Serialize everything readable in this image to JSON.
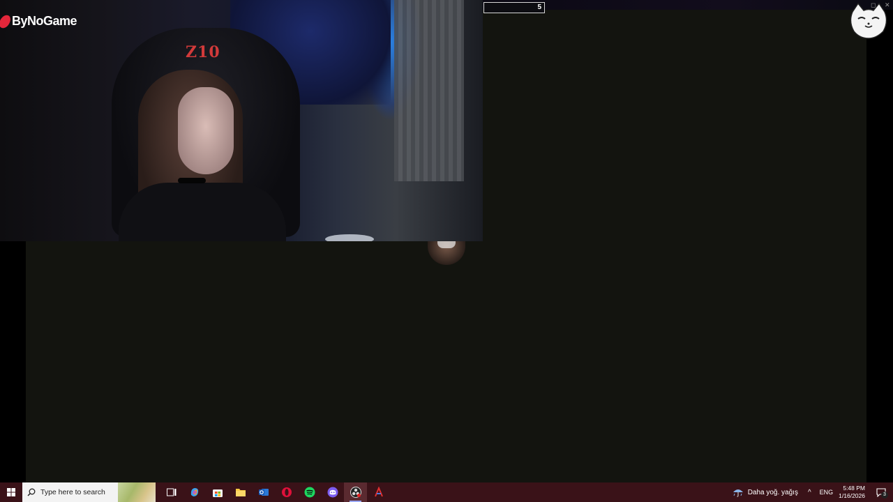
{
  "overlay": {
    "brand_name": "ByNoGame",
    "counter_value": "5",
    "chair_logo_text": "Z10"
  },
  "taskbar": {
    "search_placeholder": "Type here to search",
    "apps": [
      {
        "name": "task-view-icon"
      },
      {
        "name": "copilot-icon"
      },
      {
        "name": "microsoft-store-icon"
      },
      {
        "name": "file-explorer-icon"
      },
      {
        "name": "outlook-icon"
      },
      {
        "name": "opera-gx-icon"
      },
      {
        "name": "spotify-icon"
      },
      {
        "name": "discord-icon"
      },
      {
        "name": "obs-icon",
        "active": true
      },
      {
        "name": "app-icon"
      }
    ],
    "weather_text": "Daha yoğ. yağış",
    "language": "ENG",
    "time": "5:48 PM",
    "date": "1/16/2026",
    "notification_count": "3"
  },
  "colors": {
    "taskbar_bg": "#3a1218",
    "canvas_bg": "#13140f",
    "brand_accent": "#e3263a"
  }
}
